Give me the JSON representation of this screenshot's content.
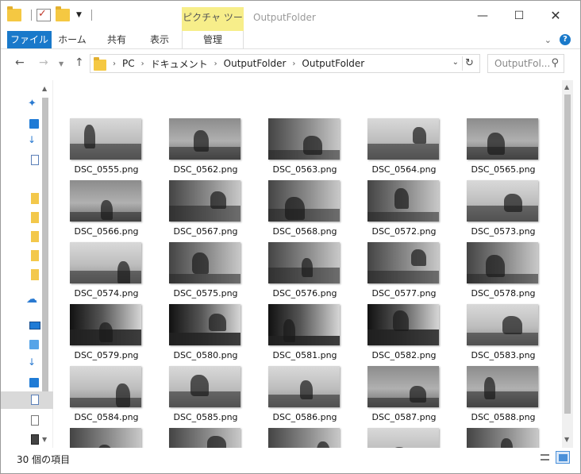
{
  "window": {
    "contextual_tab": "ピクチャ ツール",
    "title": "OutputFolder"
  },
  "ribbon": {
    "tabs": [
      "ファイル",
      "ホーム",
      "共有",
      "表示",
      "管理"
    ]
  },
  "address": {
    "crumbs": [
      "PC",
      "ドキュメント",
      "OutputFolder",
      "OutputFolder"
    ],
    "search_placeholder": "OutputFol..."
  },
  "files": [
    {
      "name": "DSC_0555.png",
      "tone": "light"
    },
    {
      "name": "DSC_0562.png",
      "tone": "mid"
    },
    {
      "name": "DSC_0563.png",
      "tone": "dark"
    },
    {
      "name": "DSC_0564.png",
      "tone": "light"
    },
    {
      "name": "DSC_0565.png",
      "tone": "mid"
    },
    {
      "name": "DSC_0566.png",
      "tone": "mid"
    },
    {
      "name": "DSC_0567.png",
      "tone": "dark"
    },
    {
      "name": "DSC_0568.png",
      "tone": "dark"
    },
    {
      "name": "DSC_0572.png",
      "tone": "dark"
    },
    {
      "name": "DSC_0573.png",
      "tone": "light"
    },
    {
      "name": "DSC_0574.png",
      "tone": "light"
    },
    {
      "name": "DSC_0575.png",
      "tone": "dark"
    },
    {
      "name": "DSC_0576.png",
      "tone": "dark"
    },
    {
      "name": "DSC_0577.png",
      "tone": "dark"
    },
    {
      "name": "DSC_0578.png",
      "tone": "dark"
    },
    {
      "name": "DSC_0579.png",
      "tone": "verydark"
    },
    {
      "name": "DSC_0580.png",
      "tone": "verydark"
    },
    {
      "name": "DSC_0581.png",
      "tone": "verydark"
    },
    {
      "name": "DSC_0582.png",
      "tone": "verydark"
    },
    {
      "name": "DSC_0583.png",
      "tone": "light"
    },
    {
      "name": "DSC_0584.png",
      "tone": "light"
    },
    {
      "name": "DSC_0585.png",
      "tone": "light"
    },
    {
      "name": "DSC_0586.png",
      "tone": "light"
    },
    {
      "name": "DSC_0587.png",
      "tone": "mid"
    },
    {
      "name": "DSC_0588.png",
      "tone": "mid"
    },
    {
      "name": "",
      "tone": "dark"
    },
    {
      "name": "",
      "tone": "dark"
    },
    {
      "name": "",
      "tone": "dark"
    },
    {
      "name": "",
      "tone": "light"
    },
    {
      "name": "",
      "tone": "dark"
    }
  ],
  "status": {
    "item_count": "30 個の項目"
  }
}
